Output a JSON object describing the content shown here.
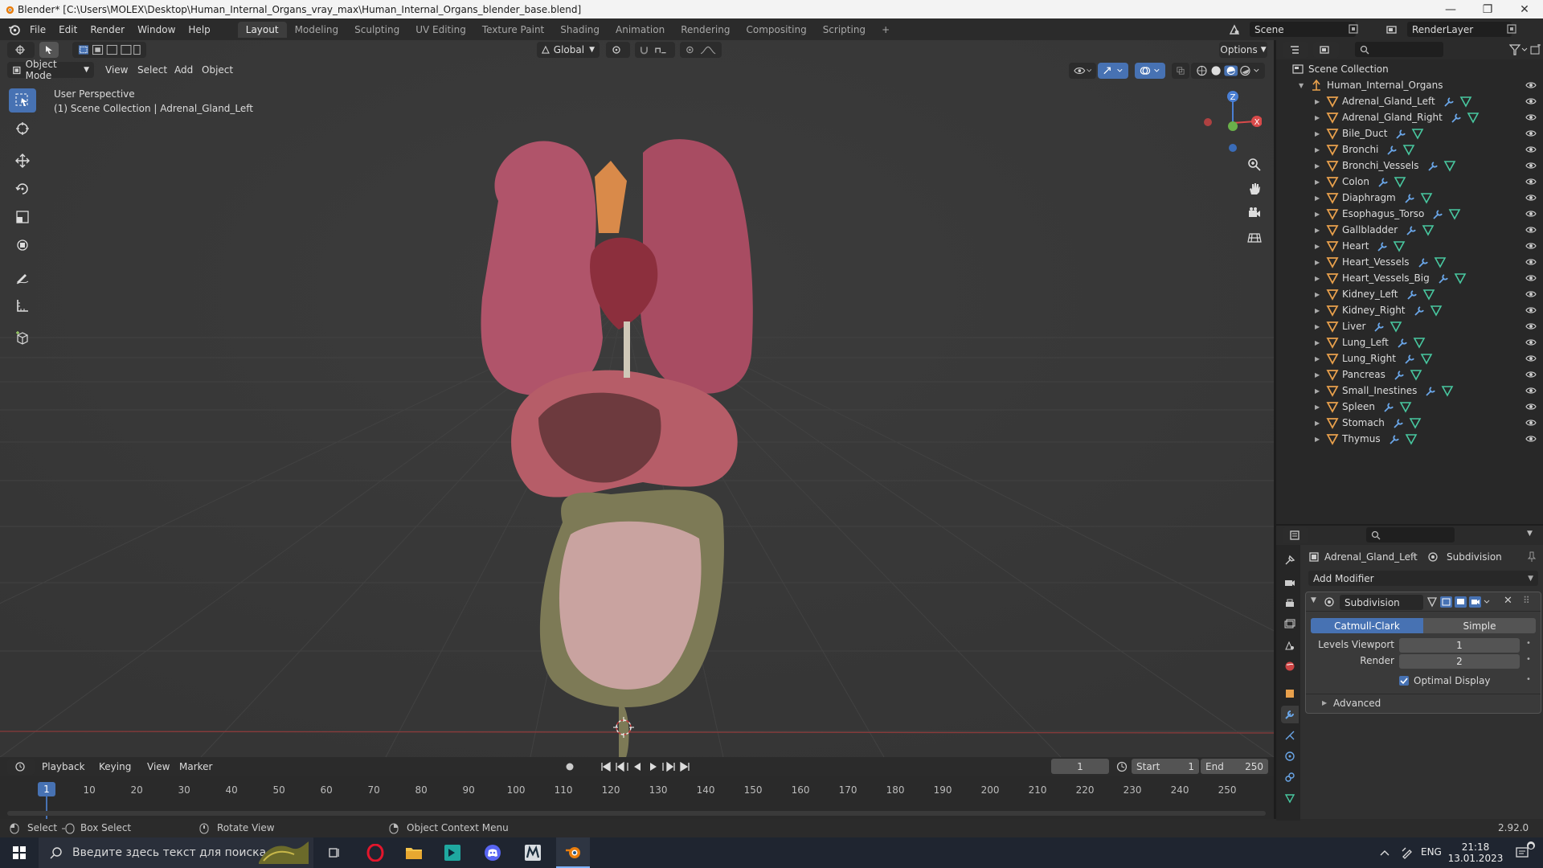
{
  "window": {
    "title": "Blender* [C:\\Users\\MOLEX\\Desktop\\Human_Internal_Organs_vray_max\\Human_Internal_Organs_blender_base.blend]"
  },
  "menubar": {
    "items": [
      "File",
      "Edit",
      "Render",
      "Window",
      "Help"
    ],
    "workspaces": [
      "Layout",
      "Modeling",
      "Sculpting",
      "UV Editing",
      "Texture Paint",
      "Shading",
      "Animation",
      "Rendering",
      "Compositing",
      "Scripting"
    ],
    "active_workspace": "Layout",
    "add_workspace": "+",
    "scene": "Scene",
    "render_layer": "RenderLayer"
  },
  "viewport": {
    "header": {
      "mode": "Object Mode",
      "menus": [
        "View",
        "Select",
        "Add",
        "Object"
      ],
      "orientation": "Global",
      "options": "Options"
    },
    "overlay": {
      "perspective": "User Perspective",
      "collection_info": "(1) Scene Collection | Adrenal_Gland_Left"
    },
    "gizmo": {
      "z": "Z",
      "x": "X"
    }
  },
  "outliner": {
    "root": "Scene Collection",
    "collection": "Human_Internal_Organs",
    "objects": [
      "Adrenal_Gland_Left",
      "Adrenal_Gland_Right",
      "Bile_Duct",
      "Bronchi",
      "Bronchi_Vessels",
      "Colon",
      "Diaphragm",
      "Esophagus_Torso",
      "Gallbladder",
      "Heart",
      "Heart_Vessels",
      "Heart_Vessels_Big",
      "Kidney_Left",
      "Kidney_Right",
      "Liver",
      "Lung_Left",
      "Lung_Right",
      "Pancreas",
      "Small_Inestines",
      "Spleen",
      "Stomach",
      "Thymus"
    ]
  },
  "properties": {
    "object_name": "Adrenal_Gland_Left",
    "modifier_context": "Subdivision",
    "add_modifier": "Add Modifier",
    "modifier": {
      "name": "Subdivision",
      "method_options": [
        "Catmull-Clark",
        "Simple"
      ],
      "active_method": "Catmull-Clark",
      "levels_viewport_label": "Levels Viewport",
      "levels_viewport": "1",
      "render_label": "Render",
      "render": "2",
      "optimal_display_label": "Optimal Display",
      "optimal_display": true,
      "advanced": "Advanced"
    }
  },
  "timeline": {
    "menus": [
      "Playback",
      "Keying",
      "View",
      "Marker"
    ],
    "current_frame": "1",
    "start_label": "Start",
    "start": "1",
    "end_label": "End",
    "end": "250",
    "ticks": [
      "10",
      "20",
      "30",
      "40",
      "50",
      "60",
      "70",
      "80",
      "90",
      "100",
      "110",
      "120",
      "130",
      "140",
      "150",
      "160",
      "170",
      "180",
      "190",
      "200",
      "210",
      "220",
      "230",
      "240",
      "250"
    ]
  },
  "statusbar": {
    "select": "Select",
    "box_select": "Box Select",
    "rotate_view": "Rotate View",
    "context_menu": "Object Context Menu",
    "version": "2.92.0"
  },
  "taskbar": {
    "search_placeholder": "Введите здесь текст для поиска",
    "language": "ENG",
    "time": "21:18",
    "date": "13.01.2023"
  },
  "colors": {
    "accent": "#4772b3",
    "viewport_bg": "#393939",
    "object_orange": "#e8a04c",
    "modifier_blue": "#6aa6e8",
    "mesh_green": "#48c8a0"
  }
}
